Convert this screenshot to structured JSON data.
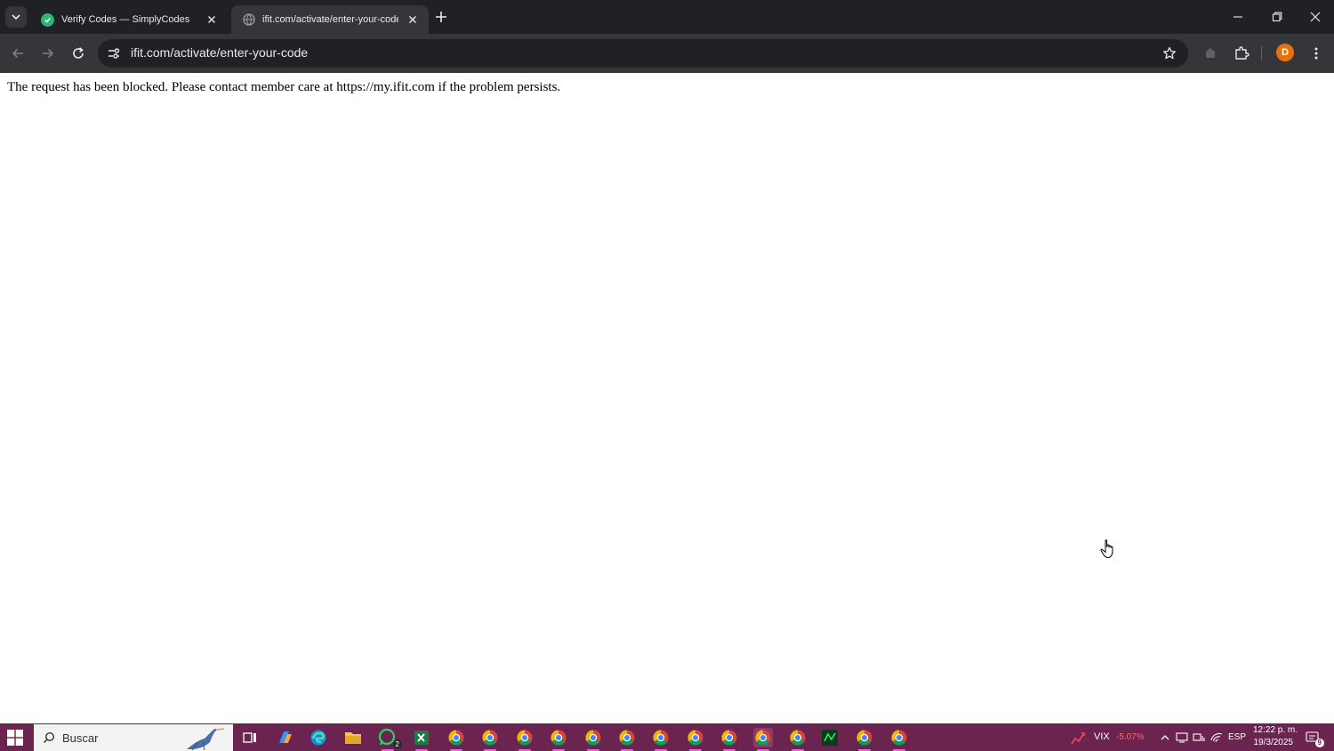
{
  "browser": {
    "tabs": [
      {
        "title": "Verify Codes — SimplyCodes",
        "active": false,
        "favicon_color": "#2bb673"
      },
      {
        "title": "ifit.com/activate/enter-your-code",
        "active": true,
        "favicon_color": "#9aa0a6"
      }
    ],
    "address_bar": {
      "url": "ifit.com/activate/enter-your-code"
    },
    "profile_initial": "D",
    "colors": {
      "frame": "#202124",
      "toolbar": "#35363a",
      "profile": "#e8710a"
    }
  },
  "page": {
    "message": "The request has been blocked. Please contact member care at https://my.ifit.com if the problem persists."
  },
  "taskbar": {
    "search_placeholder": "Buscar",
    "whatsapp_badge": "2",
    "pinned_apps": [
      {
        "icon": "task-view-icon"
      },
      {
        "icon": "copilot-icon"
      },
      {
        "icon": "edge-icon"
      },
      {
        "icon": "file-explorer-icon"
      },
      {
        "icon": "whatsapp-icon"
      },
      {
        "icon": "excel-icon"
      },
      {
        "icon": "chrome-profile-p-icon"
      },
      {
        "icon": "chrome-profile-a-icon"
      },
      {
        "icon": "chrome-profile-a2-icon"
      },
      {
        "icon": "chrome-profile-b-icon"
      },
      {
        "icon": "chrome-profile-f-icon"
      },
      {
        "icon": "chrome-profile-o-icon"
      },
      {
        "icon": "chrome-profile-v-icon"
      },
      {
        "icon": "chrome-profile-s-icon"
      },
      {
        "icon": "chrome-profile-p2-icon"
      },
      {
        "icon": "chrome-profile-d-icon"
      },
      {
        "icon": "chrome-profile-y-icon"
      },
      {
        "icon": "terminal-app-icon"
      },
      {
        "icon": "chrome-profile-g-icon"
      },
      {
        "icon": "chrome-profile-i-icon"
      }
    ],
    "tray": {
      "ticker": "VIX",
      "ticker_change": "-5.07%",
      "language": "ESP",
      "time": "12:22 p. m.",
      "date": "19/3/2025",
      "notification_count": "9"
    },
    "colors": {
      "background": "#6b2450",
      "ticker_change": "#ff6b6b"
    }
  }
}
